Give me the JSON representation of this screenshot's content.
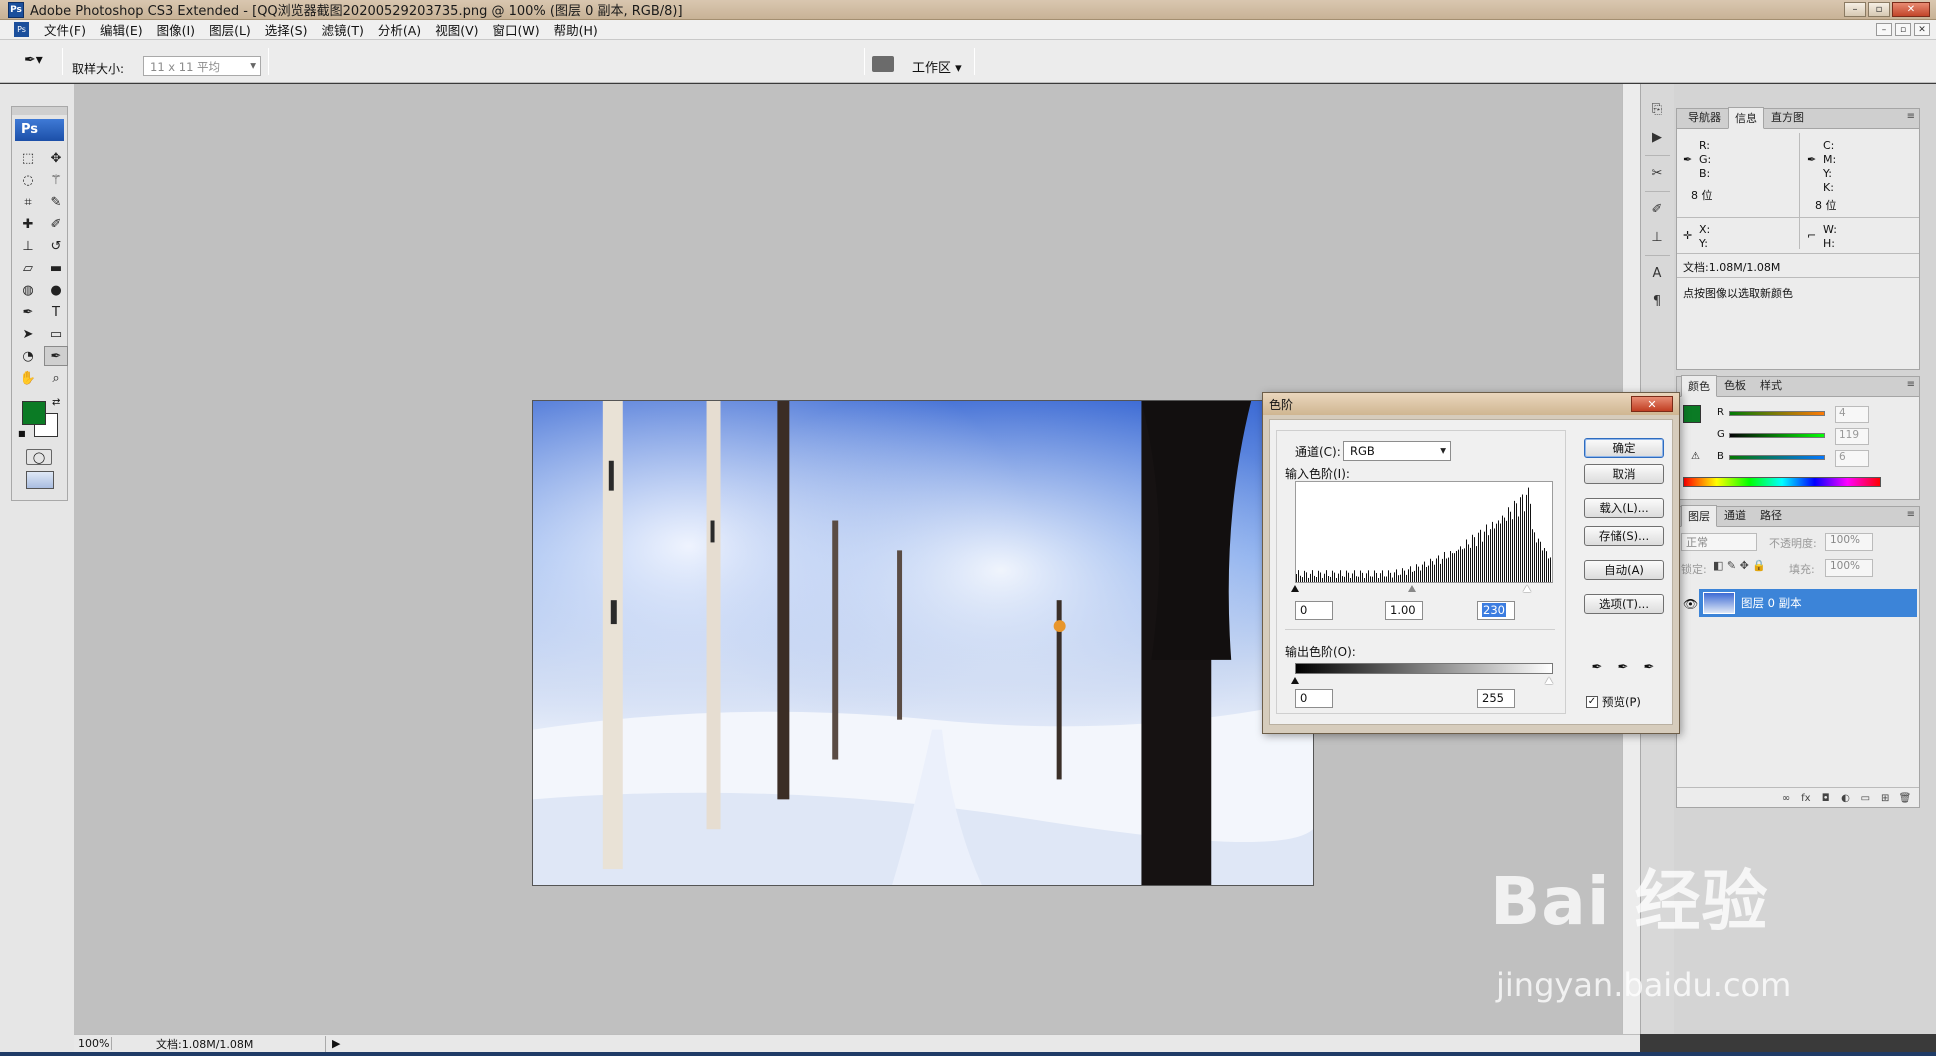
{
  "window": {
    "title": "Adobe Photoshop CS3 Extended - [QQ浏览器截图20200529203735.png @ 100% (图层 0 副本, RGB/8)]"
  },
  "menu": [
    "文件(F)",
    "编辑(E)",
    "图像(I)",
    "图层(L)",
    "选择(S)",
    "滤镜(T)",
    "分析(A)",
    "视图(V)",
    "窗口(W)",
    "帮助(H)"
  ],
  "options": {
    "sample_label": "取样大小:",
    "sample_value": "11 x 11 平均",
    "workspace_label": "工作区"
  },
  "toolbox": {
    "logo": "Ps",
    "fg_color": "#0b7b25",
    "bg_color": "#ffffff"
  },
  "status": {
    "zoom": "100%",
    "doc": "文档:1.08M/1.08M"
  },
  "info_panel": {
    "tabs": [
      "导航器",
      "信息",
      "直方图"
    ],
    "r": "R:",
    "g": "G:",
    "b": "B:",
    "bits_left": "8 位",
    "c": "C:",
    "m": "M:",
    "y": "Y:",
    "k": "K:",
    "bits_right": "8 位",
    "x": "X:",
    "ys": "Y:",
    "w": "W:",
    "h": "H:",
    "doc": "文档:1.08M/1.08M",
    "hint": "点按图像以选取新颜色"
  },
  "color_panel": {
    "tabs": [
      "颜色",
      "色板",
      "样式"
    ],
    "r_label": "R",
    "g_label": "G",
    "b_label": "B",
    "r": "4",
    "g": "119",
    "b": "6"
  },
  "layers_panel": {
    "tabs": [
      "图层",
      "通道",
      "路径"
    ],
    "blend": "正常",
    "opacity_label": "不透明度:",
    "opacity": "100%",
    "lock_label": "锁定:",
    "fill_label": "填充:",
    "fill": "100%",
    "layer_name": "图层 0 副本"
  },
  "levels_dialog": {
    "title": "色阶",
    "channel_label": "通道(C):",
    "channel": "RGB",
    "input_label": "输入色阶(I):",
    "input_black": "0",
    "input_gamma": "1.00",
    "input_white": "230",
    "output_label": "输出色阶(O):",
    "output_black": "0",
    "output_white": "255",
    "buttons": {
      "ok": "确定",
      "cancel": "取消",
      "load": "载入(L)...",
      "save": "存储(S)...",
      "auto": "自动(A)",
      "options": "选项(T)..."
    },
    "preview_label": "预览(P)",
    "preview_checked": true
  },
  "watermark": {
    "logo": "Bai 经验",
    "url": "jingyan.baidu.com"
  }
}
